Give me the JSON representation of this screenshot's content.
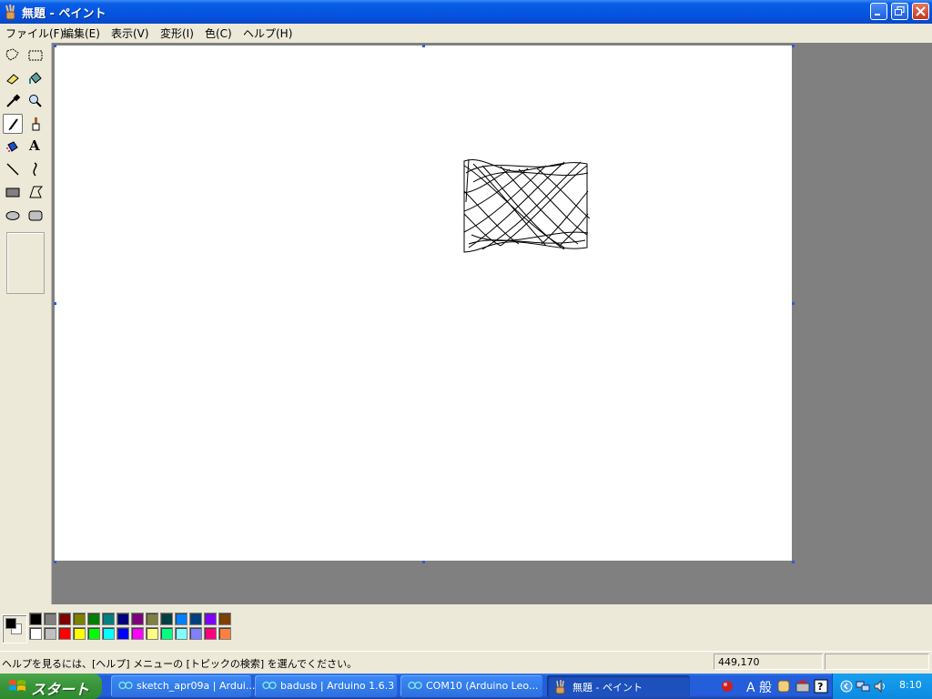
{
  "window": {
    "title": "無題 - ペイント",
    "minimize_icon": "minimize-icon",
    "restore_icon": "restore-icon",
    "close_icon": "close-icon"
  },
  "menu": {
    "items": [
      "ファイル(F)",
      "編集(E)",
      "表示(V)",
      "変形(I)",
      "色(C)",
      "ヘルプ(H)"
    ]
  },
  "toolbox": {
    "tools": [
      "free-form-select-icon",
      "rect-select-icon",
      "eraser-icon",
      "fill-icon",
      "color-picker-icon",
      "magnifier-icon",
      "pencil-icon",
      "brush-icon",
      "airbrush-icon",
      "text-icon",
      "line-icon",
      "curve-icon",
      "rectangle-icon",
      "polygon-icon",
      "ellipse-icon",
      "rounded-rect-icon"
    ],
    "selected_tool": "pencil-icon",
    "text_tool_glyph": "A"
  },
  "palette": {
    "foreground": "#000000",
    "background": "#ffffff",
    "row1": [
      "#000000",
      "#808080",
      "#800000",
      "#808000",
      "#008000",
      "#008080",
      "#000080",
      "#800080",
      "#808040",
      "#004040",
      "#0080ff",
      "#004080",
      "#8000ff",
      "#804000"
    ],
    "row2": [
      "#ffffff",
      "#c0c0c0",
      "#ff0000",
      "#ffff00",
      "#00ff00",
      "#00ffff",
      "#0000ff",
      "#ff00ff",
      "#ffff80",
      "#00ff80",
      "#80ffff",
      "#8080ff",
      "#ff0080",
      "#ff8040"
    ]
  },
  "status": {
    "help_text": "ヘルプを見るには、[ヘルプ] メニューの [トピックの検索] を選んでください。",
    "coordinates": "449,170"
  },
  "taskbar": {
    "start_label": "スタート",
    "buttons": [
      {
        "label": "sketch_apr09a | Ardui...",
        "icon": "arduino-icon",
        "active": false
      },
      {
        "label": "badusb | Arduino 1.6.3",
        "icon": "arduino-icon",
        "active": false
      },
      {
        "label": "COM10 (Arduino Leo...",
        "icon": "arduino-icon",
        "active": false
      },
      {
        "label": "無題 - ペイント",
        "icon": "paint-icon",
        "active": true
      }
    ],
    "tray_text": "A 般",
    "clock": "8:10"
  },
  "colors": {
    "titlebar": "#0553e0",
    "workspace": "#808080",
    "canvas": "#ffffff",
    "taskbar": "#245edb",
    "start_button": "#3c963c"
  }
}
